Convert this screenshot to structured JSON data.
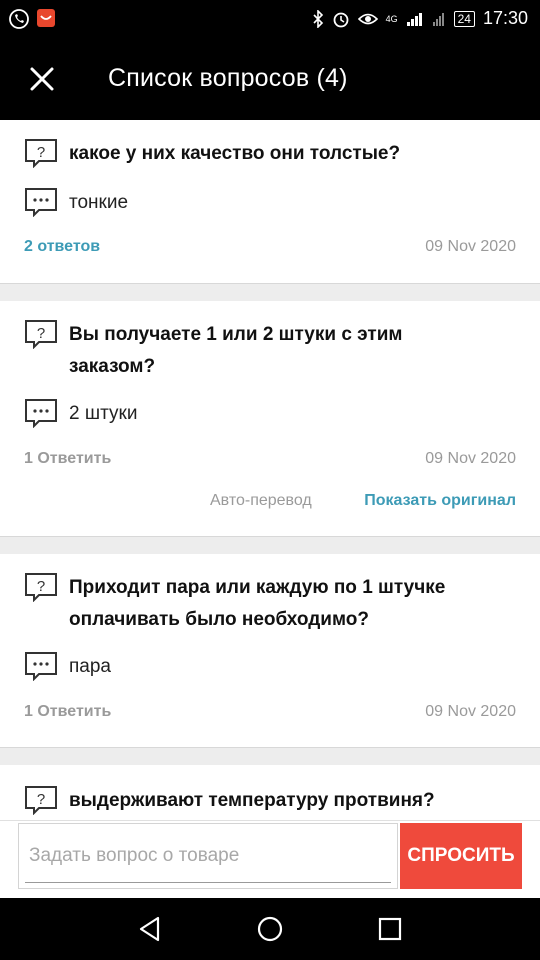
{
  "status_bar": {
    "time": "17:30",
    "battery": "24",
    "network": "4G"
  },
  "header": {
    "title": "Список вопросов (4)",
    "close_icon": "close-icon"
  },
  "questions": [
    {
      "question": "какое у них качество  они толстые?",
      "answer": "тонкие",
      "answers_count": "2 ответов",
      "date": "09 Nov 2020"
    },
    {
      "question": "Вы получаете 1 или 2 штуки с этим заказом?",
      "answer": "2 штуки",
      "answers_count": "1 Ответить",
      "date": "09 Nov 2020",
      "auto_translate": "Авто-перевод",
      "show_original": "Показать оригинал"
    },
    {
      "question": "Приходит пара или каждую по 1 штучке оплачивать было необходимо?",
      "answer": "пара",
      "answers_count": "1 Ответить",
      "date": "09 Nov 2020"
    },
    {
      "question": "выдерживают температуру протвиня?"
    }
  ],
  "ask": {
    "placeholder": "Задать вопрос о товаре",
    "button_label": "СПРОСИТЬ"
  },
  "colors": {
    "accent_blue": "#3d9bb6",
    "ask_button": "#ef4a3c",
    "header_bg": "#000000"
  }
}
